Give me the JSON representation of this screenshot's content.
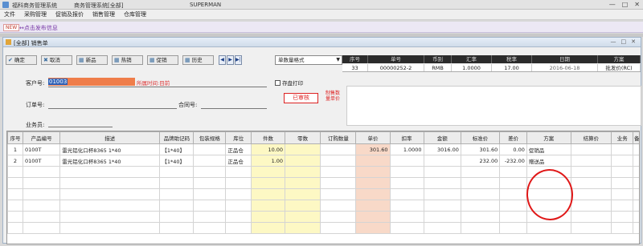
{
  "window": {
    "title": "福科商务管理系统",
    "subtitle": "商务管理系统[全部]",
    "user": "SUPERMAN",
    "controls": [
      "—",
      "□",
      "✕"
    ]
  },
  "menu": [
    "文件",
    "采购管理",
    "促销及报价",
    "销售管理",
    "仓库管理"
  ],
  "notice": {
    "badge": "NEW",
    "text": "↔点击发布信息"
  },
  "inner": {
    "title": "[全部] 销售单",
    "controls": [
      "—",
      "□",
      "✕"
    ]
  },
  "toolbar": {
    "confirm": "确定",
    "cancel": "取消",
    "new": "新品",
    "hot": "热销",
    "promo": "促销",
    "history": "历史",
    "nav": [
      "◀",
      "▶",
      "▶|"
    ],
    "format": "单数量格式"
  },
  "form": {
    "customer_label": "客户号:",
    "customer_value": "01003",
    "customer_hint": "所属时间:目前",
    "order_label": "订单号:",
    "contract_label": "合同号:",
    "salesman_label": "业务员:",
    "print_label": "存盘打印",
    "stamp": "已审核",
    "red_note": "制售数\n量单价"
  },
  "info": {
    "headers": [
      "序号",
      "单号",
      "币别",
      "汇率",
      "税率",
      "日期",
      "方案"
    ],
    "row": [
      "33",
      "00000252-2",
      "RMB",
      "1.0000",
      "17.00",
      "2016-06-18",
      "批发价(RC)"
    ]
  },
  "grid": {
    "headers": [
      "序号",
      "产品编号",
      "描述",
      "品牌助记码",
      "包装规格",
      "库位",
      "件数",
      "零数",
      "订购数量",
      "单价",
      "扣率",
      "金额",
      "标准价",
      "差价",
      "方案",
      "结算价",
      "业务",
      "备"
    ],
    "rows": [
      [
        "1",
        "0100T",
        "雷光铝化口杯8365 1*40",
        "【1*40】",
        "",
        "正品仓",
        "10.00",
        "",
        "",
        "301.60",
        "1.0000",
        "3016.00",
        "301.60",
        "0.00",
        "促销品",
        "",
        "",
        ""
      ],
      [
        "2",
        "0100T",
        "雷光铝化口杯8365 1*40",
        "【1*40】",
        "",
        "正品仓",
        "1.00",
        "",
        "",
        "",
        "",
        "",
        "232.00",
        "-232.00",
        "赠送品",
        "",
        "",
        ""
      ]
    ]
  },
  "colors": {
    "orange": "#ef7d4a",
    "red": "#e01818",
    "yellow": "#fdf8c4",
    "pink": "#f8d9c8"
  }
}
